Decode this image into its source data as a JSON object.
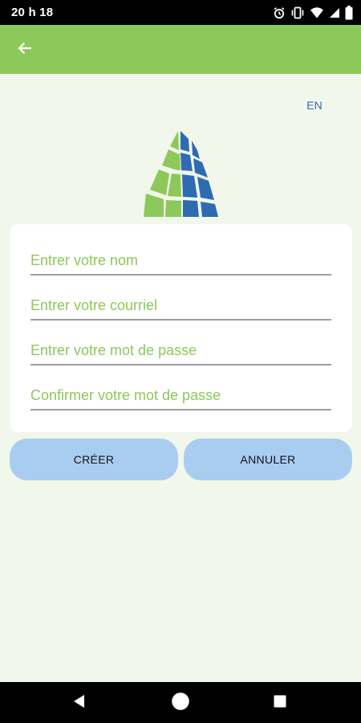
{
  "status_bar": {
    "time": "20 h 18",
    "icons": [
      "alarm-icon",
      "vibrate-icon",
      "wifi-icon",
      "signal-icon",
      "battery-icon"
    ]
  },
  "app_bar": {
    "back_icon": "arrow-left-icon",
    "color": "#8dc85a"
  },
  "language_toggle": {
    "label": "EN"
  },
  "logo": {
    "icon": "building-logo-icon",
    "colors": [
      "#8dc85a",
      "#2f6bb3"
    ]
  },
  "form": {
    "name_placeholder": "Entrer votre nom",
    "email_placeholder": "Entrer votre courriel",
    "password_placeholder": "Entrer votre mot de passe",
    "confirm_placeholder": "Confirmer votre mot de passe"
  },
  "actions": {
    "create_label": "CRÉER",
    "cancel_label": "ANNULER",
    "button_color": "#a9cdf1"
  },
  "nav_bar": {
    "icons": [
      "back-triangle-icon",
      "home-circle-icon",
      "recents-square-icon"
    ]
  }
}
